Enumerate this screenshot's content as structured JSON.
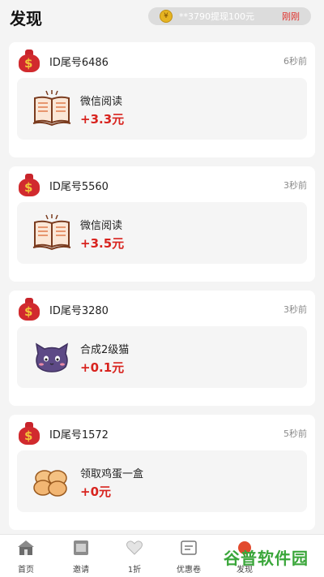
{
  "header": {
    "title": "发现"
  },
  "ticker": {
    "coin_glyph": "¥",
    "text": "**3790提现100元",
    "time": "刚刚",
    "time_color": "#e0312b"
  },
  "feed": [
    {
      "user": "ID尾号6486",
      "time": "6秒前",
      "task": "微信阅读",
      "reward": "+3.3元",
      "icon": "book-icon"
    },
    {
      "user": "ID尾号5560",
      "time": "3秒前",
      "task": "微信阅读",
      "reward": "+3.5元",
      "icon": "book-icon"
    },
    {
      "user": "ID尾号3280",
      "time": "3秒前",
      "task": "合成2级猫",
      "reward": "+0.1元",
      "icon": "cat-icon"
    },
    {
      "user": "ID尾号1572",
      "time": "5秒前",
      "task": "领取鸡蛋一盒",
      "reward": "+0元",
      "icon": "eggs-icon"
    }
  ],
  "tabbar": {
    "items": [
      {
        "label": "首页",
        "icon": "home-icon"
      },
      {
        "label": "邀请",
        "icon": "invite-icon"
      },
      {
        "label": "1折",
        "icon": "heart-icon"
      },
      {
        "label": "优惠卷",
        "icon": "coupon-icon"
      },
      {
        "label": "发现",
        "icon": "discover-icon"
      }
    ]
  },
  "watermark": {
    "text": "谷普软件园"
  },
  "colors": {
    "reward": "#d8231e",
    "bag": "#d12a2e",
    "watermark": "#3aa63a"
  }
}
